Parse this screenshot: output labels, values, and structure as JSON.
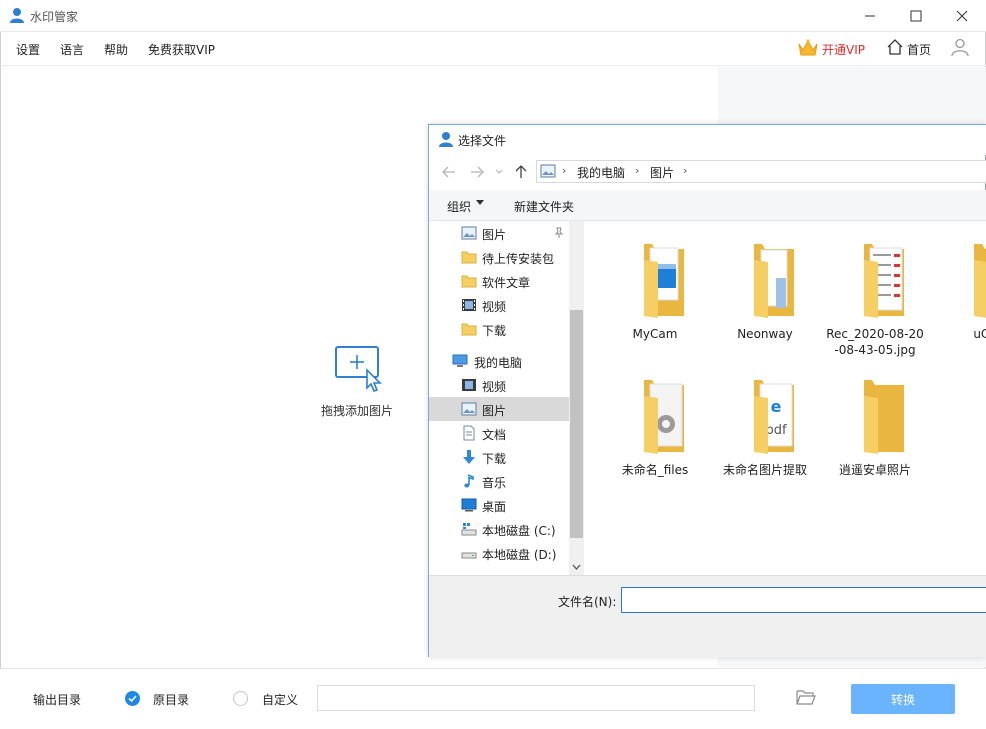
{
  "window": {
    "title": "水印管家"
  },
  "menu": [
    "设置",
    "语言",
    "帮助",
    "免费获取VIP"
  ],
  "header": {
    "vip_label": "开通VIP",
    "home_label": "首页"
  },
  "drop_zone": {
    "label": "拖拽添加图片"
  },
  "bottom": {
    "output_label": "输出目录",
    "radio_original": "原目录",
    "radio_custom": "自定义",
    "path_value": "",
    "convert_label": "转换"
  },
  "dialog": {
    "title": "选择文件",
    "breadcrumb": [
      "我的电脑",
      "图片"
    ],
    "toolbar": {
      "organize": "组织",
      "new_folder": "新建文件夹"
    },
    "nav_items": [
      {
        "label": "图片",
        "icon": "pictures-icon",
        "pinned": true
      },
      {
        "label": "待上传安装包",
        "icon": "folder-icon"
      },
      {
        "label": "软件文章",
        "icon": "folder-icon"
      },
      {
        "label": "视频",
        "icon": "videos-icon"
      },
      {
        "label": "下载",
        "icon": "folder-icon"
      },
      {
        "label": "我的电脑",
        "icon": "computer-icon",
        "group": true
      },
      {
        "label": "视频",
        "icon": "videos-icon"
      },
      {
        "label": "图片",
        "icon": "pictures-icon",
        "selected": true
      },
      {
        "label": "文档",
        "icon": "documents-icon"
      },
      {
        "label": "下载",
        "icon": "downloads-icon"
      },
      {
        "label": "音乐",
        "icon": "music-icon"
      },
      {
        "label": "桌面",
        "icon": "desktop-icon"
      },
      {
        "label": "本地磁盘 (C:)",
        "icon": "drive-c-icon"
      },
      {
        "label": "本地磁盘 (D:)",
        "icon": "drive-d-icon"
      }
    ],
    "files": [
      {
        "name": "MyCam",
        "kind": "folder-video"
      },
      {
        "name": "Neonway",
        "kind": "folder-docs"
      },
      {
        "name": "Rec_2020-08-20\n-08-43-05.jpg",
        "kind": "folder-screens"
      },
      {
        "name": "uCo",
        "kind": "folder"
      },
      {
        "name": "未命名_files",
        "kind": "folder-settings"
      },
      {
        "name": "未命名图片提取",
        "kind": "folder-pdf"
      },
      {
        "name": "逍遥安卓照片",
        "kind": "folder"
      }
    ],
    "filename_label": "文件名(N):",
    "filename_value": ""
  },
  "colors": {
    "accent": "#1e88e5",
    "vip": "#e02b2b",
    "convert_button": "#69b3ff",
    "folder": "#f5cf64"
  }
}
